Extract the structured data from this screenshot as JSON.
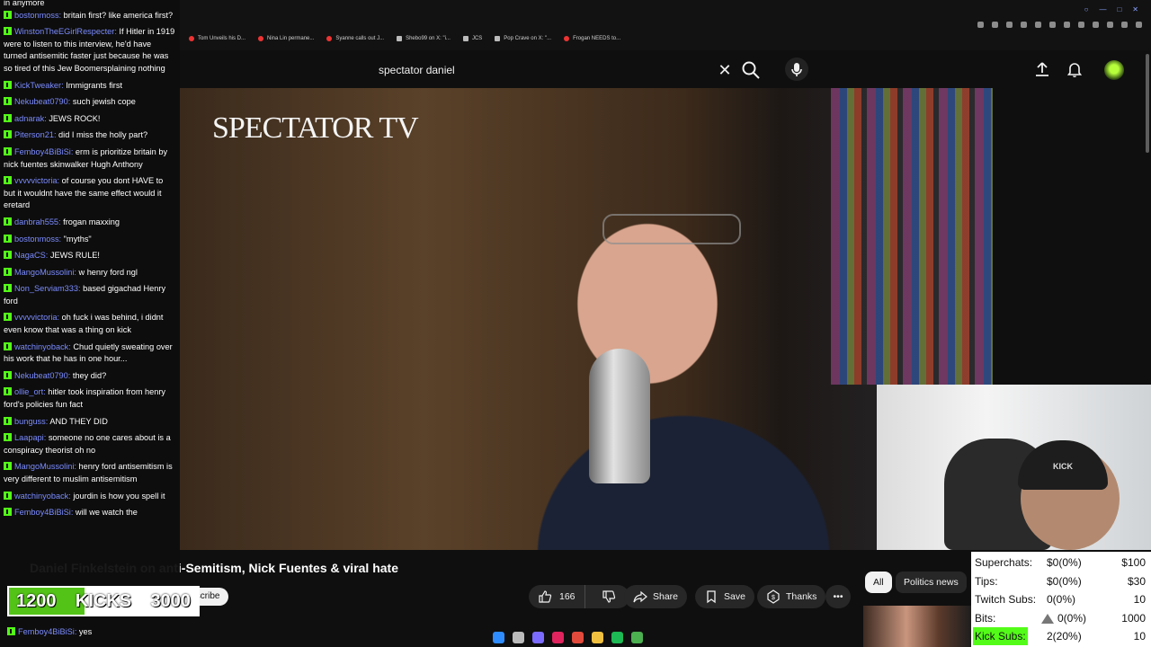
{
  "browser": {
    "tabs": [
      {
        "label": "Tom Unveils his D...",
        "fav": "youtube"
      },
      {
        "label": "Nina Lin permane...",
        "fav": "youtube"
      },
      {
        "label": "Syanne calls out J...",
        "fav": "youtube"
      },
      {
        "label": "Shebo99 on X: \"i...",
        "fav": "x"
      },
      {
        "label": "JCS",
        "fav": "x"
      },
      {
        "label": "Pop Crave on X: \"...",
        "fav": "x"
      },
      {
        "label": "Frogan NEEDS to...",
        "fav": "youtube"
      }
    ]
  },
  "youtube": {
    "search_query": "spectator daniel",
    "video_logo": "SPECTATOR TV",
    "title": "Daniel Finkelstein on anti-Semitism, Nick Fuentes & viral hate",
    "subscribe_label": "Subscribe",
    "like_count": "166",
    "share_label": "Share",
    "save_label": "Save",
    "thanks_label": "Thanks",
    "chips": [
      "All",
      "Politics news"
    ]
  },
  "chat": {
    "first_line": "in anymore",
    "messages": [
      {
        "user": "bostonmoss",
        "text": "britain first? like america first?"
      },
      {
        "user": "WinstonTheEGirlRespecter",
        "text": "If Hitler in 1919 were to listen to this interview, he'd have turned antisemitic faster just because he was so tired of this Jew Boomersplaining nothing"
      },
      {
        "user": "KickTweaker",
        "text": "Immigrants first"
      },
      {
        "user": "Nekubeat0790",
        "text": "such jewish cope"
      },
      {
        "user": "adnarak",
        "text": "JEWS ROCK!"
      },
      {
        "user": "Piterson21",
        "text": "did I miss the holly part?"
      },
      {
        "user": "Femboy4BiBiSi",
        "text": "erm is prioritize britain by nick fuentes skinwalker Hugh Anthony"
      },
      {
        "user": "vvvvvictoria",
        "text": "of course you dont HAVE to but it wouldnt have the same effect would it eretard"
      },
      {
        "user": "danbrah555",
        "text": "frogan maxxing"
      },
      {
        "user": "bostonmoss",
        "text": "\"myths\""
      },
      {
        "user": "NagaCS",
        "text": "JEWS RULE!"
      },
      {
        "user": "MangoMussolini",
        "text": "w henry ford ngl"
      },
      {
        "user": "Non_Serviam333",
        "text": "based gigachad Henry ford"
      },
      {
        "user": "vvvvvictoria",
        "text": "oh fuck i was behind, i didnt even know that was a thing on kick"
      },
      {
        "user": "watchinyoback",
        "text": "Chud quietly sweating over his work that he has in one hour..."
      },
      {
        "user": "Nekubeat0790",
        "text": "they did?"
      },
      {
        "user": "ollie_ort",
        "text": "hitler took inspiration from henry ford's policies fun fact"
      },
      {
        "user": "bunguss",
        "text": "AND THEY DID"
      },
      {
        "user": "Laapapi",
        "text": "someone no one cares about is a conspiracy theorist oh no"
      },
      {
        "user": "MangoMussolini",
        "text": "henry ford antisemitism is very different to muslim antisemitism"
      },
      {
        "user": "watchinyoback",
        "text": "jourdin is how you spell it"
      },
      {
        "user": "Femboy4BiBiSi",
        "text": "will we watch the"
      }
    ],
    "last_message": {
      "user": "Femboy4BiBiSi",
      "text": "yes"
    }
  },
  "kicks_goal": {
    "current": "1200",
    "label": "KICKS",
    "target": "3000",
    "progress": 0.4
  },
  "stats": [
    {
      "label": "Superchats:",
      "mid": "$0(0%)",
      "right": "$100",
      "highlight": false
    },
    {
      "label": "Tips:",
      "mid": "$0(0%)",
      "right": "$30",
      "highlight": false
    },
    {
      "label": "Twitch Subs:",
      "mid": "0(0%)",
      "right": "10",
      "highlight": false
    },
    {
      "label": "Bits:",
      "mid": "0(0%)",
      "right": "1000",
      "highlight": false
    },
    {
      "label": "Kick Subs:",
      "mid": "2(20%)",
      "right": "10",
      "highlight": true
    }
  ],
  "colors": {
    "kick_green": "#53fc18",
    "chat_user": "#7b8cff",
    "yt_bg": "#0f0f0f"
  }
}
